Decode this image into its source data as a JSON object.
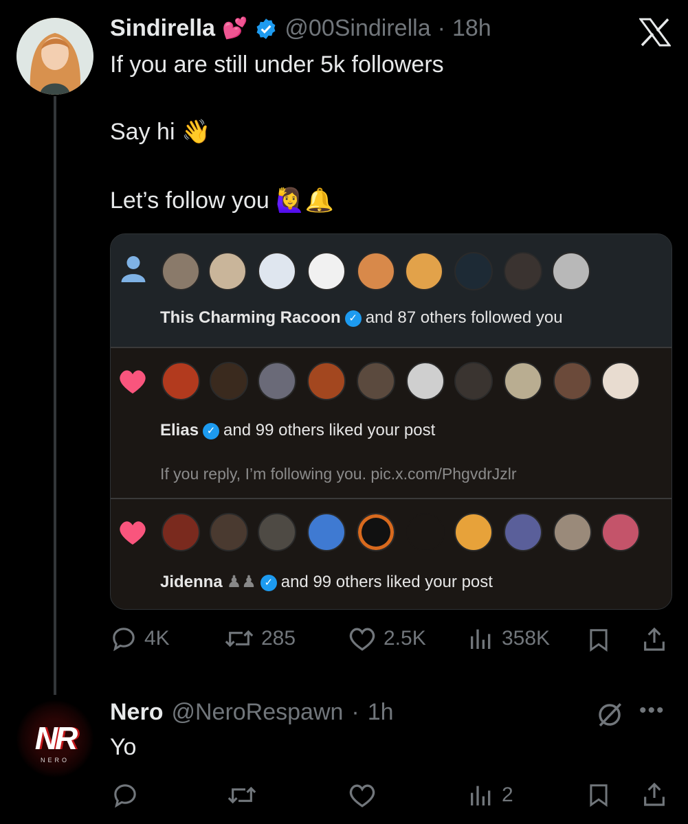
{
  "tweet": {
    "author_name": "Sindirella",
    "name_emoji": "💕",
    "handle": "@00Sindirella",
    "separator": "·",
    "time": "18h",
    "lines": [
      "If you are still under 5k followers",
      "Say hi 👋",
      "Let’s follow you 🙋‍♀️🔔"
    ],
    "stats": {
      "replies": "4K",
      "reposts": "285",
      "likes": "2.5K",
      "views": "358K"
    }
  },
  "embedded_image": {
    "follow_row": {
      "name": "This Charming Racoon",
      "rest": "and 87 others followed you"
    },
    "like_row_1": {
      "name": "Elias",
      "rest": "and 99 others liked your post",
      "sub": "If you reply, I’m following you. pic.x.com/PhgvdrJzlr"
    },
    "like_row_2": {
      "name": "Jidenna",
      "rest": "and 99 others liked your post"
    }
  },
  "reply": {
    "author_name": "Nero",
    "handle": "@NeroRespawn",
    "separator": "·",
    "time": "1h",
    "text": "Yo",
    "avatar_letters": "NR",
    "avatar_caption": "NERO",
    "stats": {
      "views": "2"
    }
  },
  "icons": {
    "logo": "x-logo-icon",
    "verified": "verified-badge-icon",
    "reply": "reply-icon",
    "repost": "repost-icon",
    "like": "heart-icon",
    "views": "views-chart-icon",
    "bookmark": "bookmark-icon",
    "share": "share-icon",
    "more": "more-icon",
    "grok": "no-entry-icon"
  },
  "colors": {
    "background": "#000000",
    "text": "#e7e9ea",
    "muted": "#71767b",
    "verified": "#1d9bf0",
    "like_pink": "#f91880"
  }
}
